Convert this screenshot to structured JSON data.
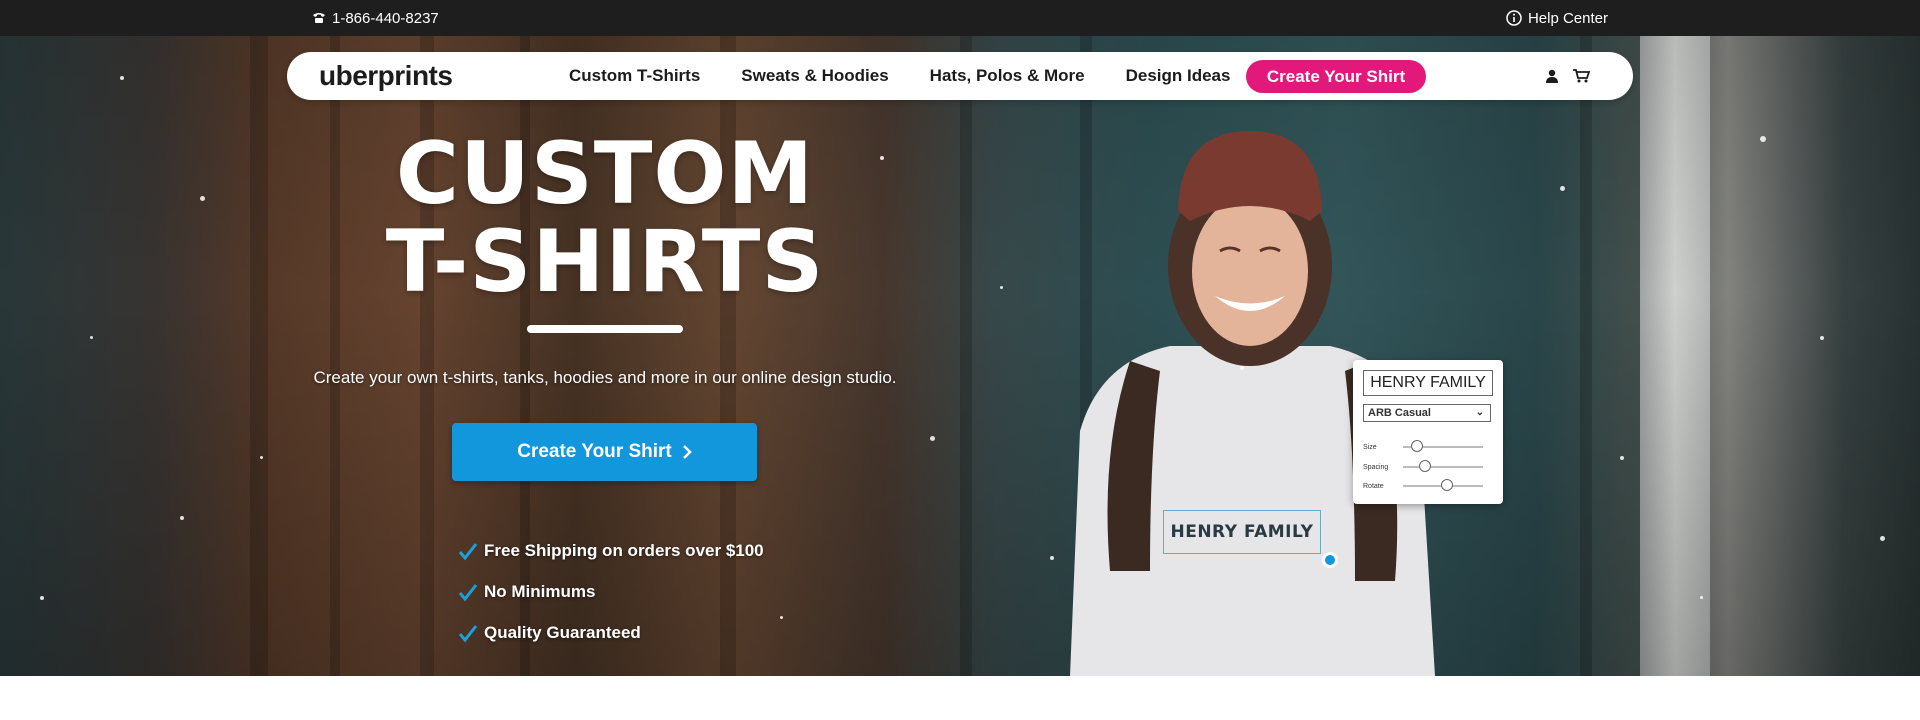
{
  "topbar": {
    "phone": "1-866-440-8237",
    "help": "Help Center",
    "phone_icon": "phone-icon",
    "help_icon": "info-icon"
  },
  "nav": {
    "logo": "uberprints",
    "links": [
      "Custom T-Shirts",
      "Sweats & Hoodies",
      "Hats, Polos & More",
      "Design Ideas"
    ],
    "cta": "Create Your Shirt",
    "icons": [
      "user-icon",
      "cart-icon"
    ]
  },
  "hero": {
    "title_line1": "CUSTOM",
    "title_line2": "T-SHIRTS",
    "subtitle": "Create your own t-shirts, tanks, hoodies and more in our online design studio.",
    "cta": "Create Your Shirt",
    "features": [
      "Free Shipping on orders over $100",
      "No Minimums",
      "Quality Guaranteed"
    ]
  },
  "design_panel": {
    "text_value": "HENRY FAMILY",
    "font": "ARB Casual",
    "sliders": [
      {
        "label": "Size",
        "level": 0.18
      },
      {
        "label": "Spacing",
        "level": 0.28
      },
      {
        "label": "Rotate",
        "level": 0.55
      }
    ]
  },
  "shirt_print": "HENRY FAMILY",
  "colors": {
    "topbar": "#1e1e1e",
    "nav_cta": "#e2197a",
    "hero_cta": "#1296dc",
    "check": "#1aa0dc"
  }
}
